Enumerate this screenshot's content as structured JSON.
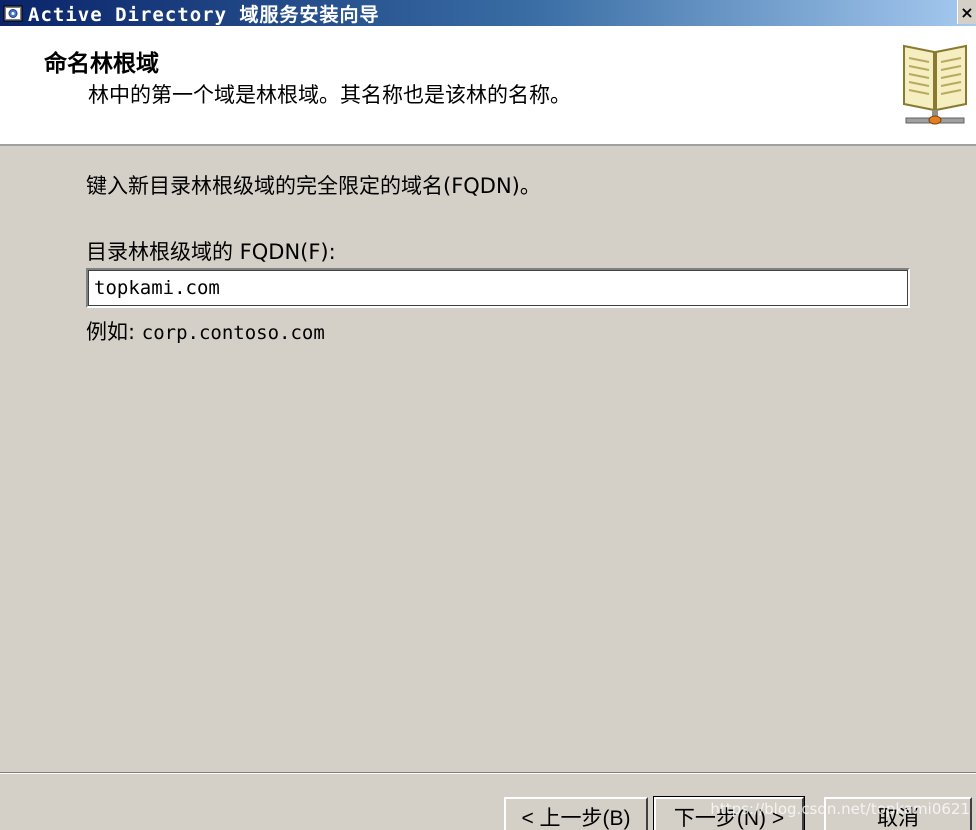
{
  "window": {
    "title": "Active Directory 域服务安装向导",
    "close_label": "×"
  },
  "header": {
    "title": "命名林根域",
    "description": "林中的第一个域是林根域。其名称也是该林的名称。",
    "icon": "directory-book-icon"
  },
  "content": {
    "instruction": "键入新目录林根级域的完全限定的域名(FQDN)。",
    "fqdn_label": "目录林根级域的 FQDN(F):",
    "fqdn_value": "topkami.com",
    "example_prefix": "例如:",
    "example_value": "corp.contoso.com"
  },
  "buttons": {
    "back_label": "< 上一步(B)",
    "next_label": "下一步(N) >",
    "cancel_label": "取消"
  },
  "watermark": "https://blog.csdn.net/topkami0621",
  "colors": {
    "title_gradient_start": "#0a246a",
    "title_gradient_end": "#a6caf0",
    "dialog_bg": "#d4d0c8",
    "header_bg": "#ffffff"
  }
}
